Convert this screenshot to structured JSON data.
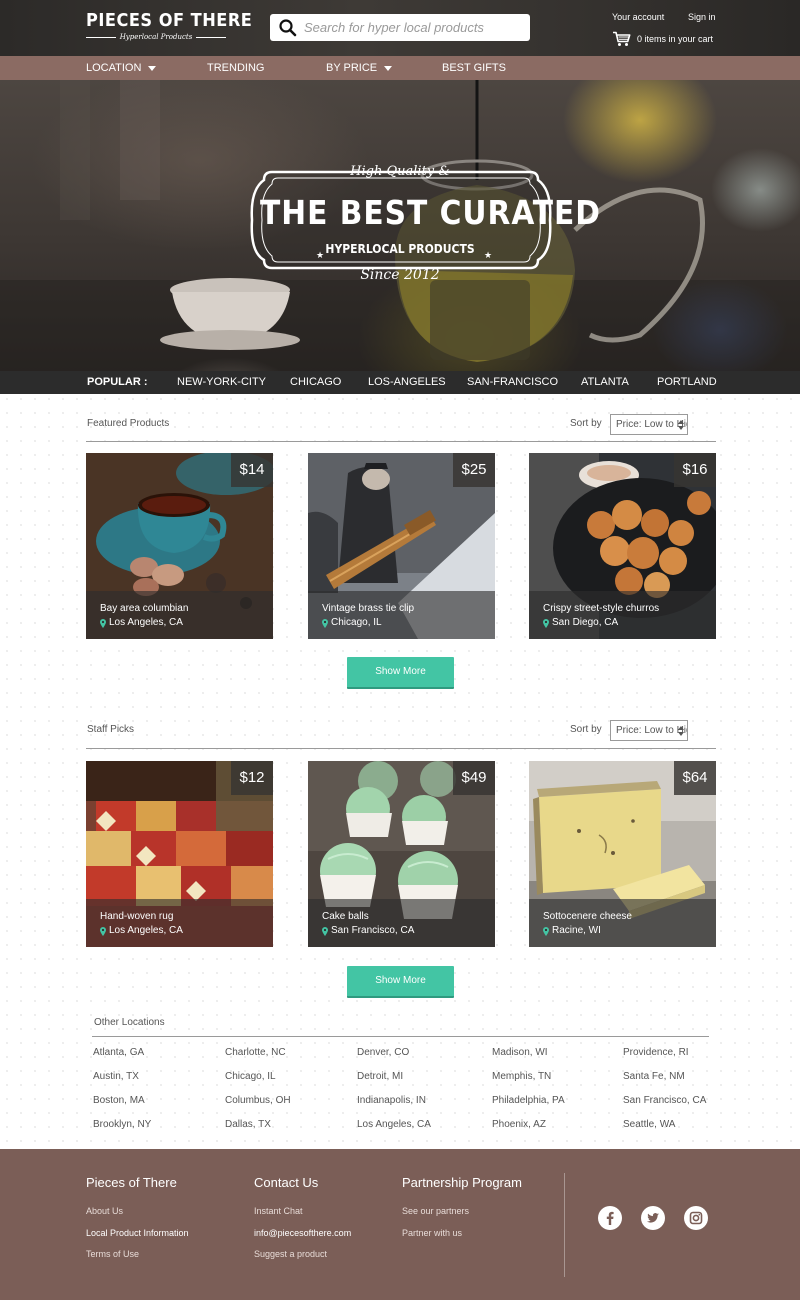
{
  "header": {
    "logo_title": "PIECES OF THERE",
    "logo_tagline": "Hyperlocal Products",
    "search_placeholder": "Search for hyper local products",
    "account_label": "Your account",
    "signin_label": "Sign in",
    "cart_label": "0 items in your cart"
  },
  "nav": {
    "items": [
      {
        "label": "LOCATION",
        "dropdown": true
      },
      {
        "label": "TRENDING",
        "dropdown": false
      },
      {
        "label": "BY PRICE",
        "dropdown": true
      },
      {
        "label": "BEST GIFTS",
        "dropdown": false
      }
    ]
  },
  "hero": {
    "badge_top": "High Quality &",
    "badge_main": "THE BEST CURATED",
    "badge_sub": "HYPERLOCAL PRODUCTS",
    "badge_bottom": "Since 2012"
  },
  "popular": {
    "label": "POPULAR :",
    "cities": [
      "NEW-YORK-CITY",
      "CHICAGO",
      "LOS-ANGELES",
      "SAN-FRANCISCO",
      "ATLANTA",
      "PORTLAND"
    ]
  },
  "featured": {
    "title": "Featured Products",
    "sort_label": "Sort by",
    "sort_value": "Price: Low to High",
    "show_more": "Show More",
    "products": [
      {
        "price": "$14",
        "name": "Bay area columbian",
        "location": "Los Angeles, CA",
        "image": "teacup-macarons"
      },
      {
        "price": "$25",
        "name": "Vintage brass tie clip",
        "location": "Chicago, IL",
        "image": "tie-clip-photo"
      },
      {
        "price": "$16",
        "name": "Crispy street-style churros",
        "location": "San Diego, CA",
        "image": "churros-pan"
      }
    ]
  },
  "staff": {
    "title": "Staff Picks",
    "sort_label": "Sort by",
    "sort_value": "Price: Low to High",
    "show_more": "Show More",
    "products": [
      {
        "price": "$12",
        "name": "Hand-woven rug",
        "location": "Los Angeles, CA",
        "image": "woven-rug"
      },
      {
        "price": "$49",
        "name": "Cake balls",
        "location": "San Francisco, CA",
        "image": "green-cake-balls"
      },
      {
        "price": "$64",
        "name": "Sottocenere cheese",
        "location": "Racine, WI",
        "image": "truffle-cheese"
      }
    ]
  },
  "other_locations": {
    "title": "Other Locations",
    "columns": [
      [
        "Atlanta, GA",
        "Austin, TX",
        "Boston, MA",
        "Brooklyn, NY"
      ],
      [
        "Charlotte, NC",
        "Chicago, IL",
        "Columbus, OH",
        "Dallas, TX"
      ],
      [
        "Denver, CO",
        "Detroit, MI",
        "Indianapolis, IN",
        "Los Angeles, CA"
      ],
      [
        "Madison, WI",
        "Memphis, TN",
        "Philadelphia, PA",
        "Phoenix, AZ"
      ],
      [
        "Providence, RI",
        "Santa Fe, NM",
        "San Francisco, CA",
        "Seattle, WA"
      ]
    ]
  },
  "footer": {
    "col1": {
      "heading": "Pieces of There",
      "links": [
        "About Us",
        "Local Product Information",
        "Terms of Use"
      ]
    },
    "col2": {
      "heading": "Contact Us",
      "links": [
        "Instant Chat",
        "info@piecesofthere.com",
        "Suggest a product"
      ]
    },
    "col3": {
      "heading": "Partnership Program",
      "links": [
        "See our partners",
        "Partner with us"
      ]
    },
    "social": [
      "facebook-icon",
      "twitter-icon",
      "instagram-icon"
    ]
  },
  "colors": {
    "nav_bg": "#8b6b63",
    "footer_bg": "#7b5e57",
    "accent_button": "#43c5a4",
    "location_pin": "#43c5a4",
    "popular_bar": "#2c2c2c"
  }
}
